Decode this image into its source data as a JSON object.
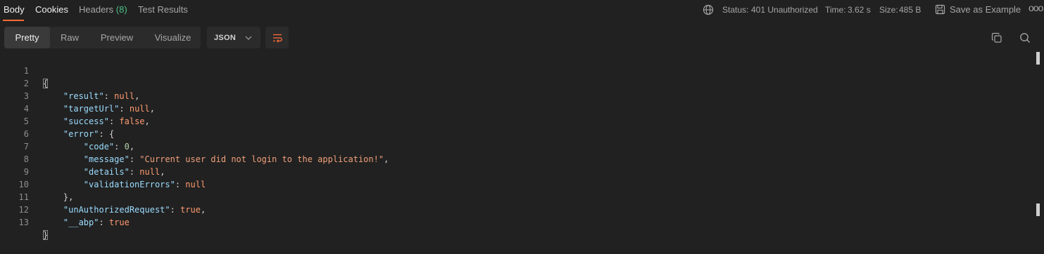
{
  "tabs": [
    {
      "label": "Body",
      "active": true
    },
    {
      "label": "Cookies",
      "active": false
    },
    {
      "label": "Headers",
      "count": "(8)",
      "active": false
    },
    {
      "label": "Test Results",
      "active": false
    }
  ],
  "status": {
    "status_label": "Status:",
    "status_value": "401 Unauthorized",
    "time_label": "Time:",
    "time_value": "3.62 s",
    "size_label": "Size:",
    "size_value": "485 B"
  },
  "save_as_example": "Save as Example",
  "more_menu": "ooo",
  "view_modes": [
    "Pretty",
    "Raw",
    "Preview",
    "Visualize"
  ],
  "format_select": "JSON",
  "colors": {
    "accent": "#ff6c37",
    "success_green": "#49c287",
    "background": "#212121",
    "key": "#9cdcfe",
    "keyword": "#ff9b70",
    "string": "#f0a07a"
  },
  "code_lines": [
    {
      "n": "1"
    },
    {
      "n": "2",
      "key": "\"result\"",
      "val": "null",
      "tail": ","
    },
    {
      "n": "3",
      "key": "\"targetUrl\"",
      "val": "null",
      "tail": ","
    },
    {
      "n": "4",
      "key": "\"success\"",
      "val": "false",
      "tail": ","
    },
    {
      "n": "5",
      "key": "\"error\"",
      "val": "{"
    },
    {
      "n": "6",
      "key": "\"code\"",
      "val": "0",
      "tail": ","
    },
    {
      "n": "7",
      "key": "\"message\"",
      "val": "\"Current user did not login to the application!\"",
      "tail": ","
    },
    {
      "n": "8",
      "key": "\"details\"",
      "val": "null",
      "tail": ","
    },
    {
      "n": "9",
      "key": "\"validationErrors\"",
      "val": "null"
    },
    {
      "n": "10",
      "val": "}",
      "tail": ","
    },
    {
      "n": "11",
      "key": "\"unAuthorizedRequest\"",
      "val": "true",
      "tail": ","
    },
    {
      "n": "12",
      "key": "\"__abp\"",
      "val": "true"
    },
    {
      "n": "13"
    }
  ]
}
